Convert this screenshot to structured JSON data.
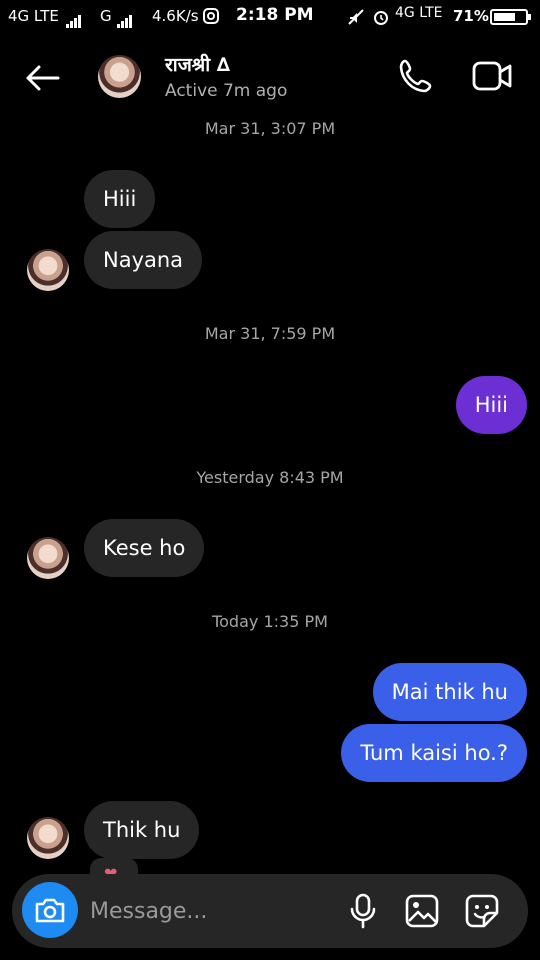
{
  "status_bar": {
    "network_left": "4G LTE",
    "network_g": "G",
    "speed": "4.6K/s",
    "time": "2:18 PM",
    "network_right": "4G LTE",
    "battery_text": "71%",
    "battery_level": 0.71
  },
  "header": {
    "name": "राजश्री ∆",
    "status": "Active 7m ago"
  },
  "timestamps": [
    "Mar 31, 3:07 PM",
    "Mar 31, 7:59 PM",
    "Yesterday 8:43 PM",
    "Today 1:35 PM"
  ],
  "messages": [
    {
      "text": "Hiii",
      "from": "them"
    },
    {
      "text": "Nayana",
      "from": "them"
    },
    {
      "text": "Hiii",
      "from": "me"
    },
    {
      "text": "Kese ho",
      "from": "them"
    },
    {
      "text": "Mai thik hu",
      "from": "me"
    },
    {
      "text": "Tum kaisi ho.?",
      "from": "me"
    },
    {
      "text": "Thik hu",
      "from": "them"
    }
  ],
  "reaction": {
    "icon": "heart-icon",
    "glyph": "❤"
  },
  "composer": {
    "placeholder": "Message..."
  },
  "colors": {
    "incoming": "#262626",
    "outgoing_purple": "#6c2fd3",
    "outgoing_blue": "#3a5fe8",
    "camera": "#1d8bf1"
  }
}
